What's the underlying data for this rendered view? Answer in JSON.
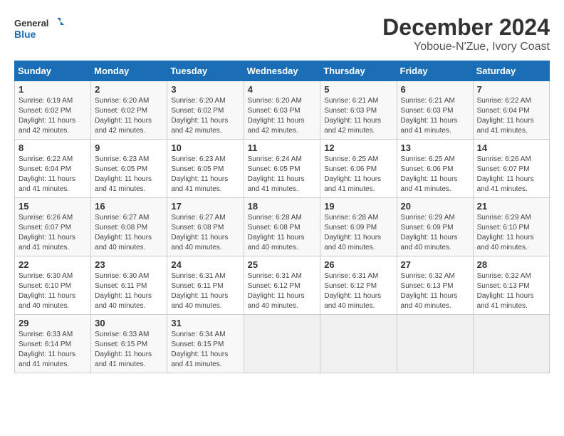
{
  "logo": {
    "text_general": "General",
    "text_blue": "Blue"
  },
  "title": "December 2024",
  "subtitle": "Yoboue-N'Zue, Ivory Coast",
  "days_of_week": [
    "Sunday",
    "Monday",
    "Tuesday",
    "Wednesday",
    "Thursday",
    "Friday",
    "Saturday"
  ],
  "weeks": [
    [
      {
        "day": "1",
        "sunrise": "6:19 AM",
        "sunset": "6:02 PM",
        "daylight": "11 hours and 42 minutes."
      },
      {
        "day": "2",
        "sunrise": "6:20 AM",
        "sunset": "6:02 PM",
        "daylight": "11 hours and 42 minutes."
      },
      {
        "day": "3",
        "sunrise": "6:20 AM",
        "sunset": "6:02 PM",
        "daylight": "11 hours and 42 minutes."
      },
      {
        "day": "4",
        "sunrise": "6:20 AM",
        "sunset": "6:03 PM",
        "daylight": "11 hours and 42 minutes."
      },
      {
        "day": "5",
        "sunrise": "6:21 AM",
        "sunset": "6:03 PM",
        "daylight": "11 hours and 42 minutes."
      },
      {
        "day": "6",
        "sunrise": "6:21 AM",
        "sunset": "6:03 PM",
        "daylight": "11 hours and 41 minutes."
      },
      {
        "day": "7",
        "sunrise": "6:22 AM",
        "sunset": "6:04 PM",
        "daylight": "11 hours and 41 minutes."
      }
    ],
    [
      {
        "day": "8",
        "sunrise": "6:22 AM",
        "sunset": "6:04 PM",
        "daylight": "11 hours and 41 minutes."
      },
      {
        "day": "9",
        "sunrise": "6:23 AM",
        "sunset": "6:05 PM",
        "daylight": "11 hours and 41 minutes."
      },
      {
        "day": "10",
        "sunrise": "6:23 AM",
        "sunset": "6:05 PM",
        "daylight": "11 hours and 41 minutes."
      },
      {
        "day": "11",
        "sunrise": "6:24 AM",
        "sunset": "6:05 PM",
        "daylight": "11 hours and 41 minutes."
      },
      {
        "day": "12",
        "sunrise": "6:25 AM",
        "sunset": "6:06 PM",
        "daylight": "11 hours and 41 minutes."
      },
      {
        "day": "13",
        "sunrise": "6:25 AM",
        "sunset": "6:06 PM",
        "daylight": "11 hours and 41 minutes."
      },
      {
        "day": "14",
        "sunrise": "6:26 AM",
        "sunset": "6:07 PM",
        "daylight": "11 hours and 41 minutes."
      }
    ],
    [
      {
        "day": "15",
        "sunrise": "6:26 AM",
        "sunset": "6:07 PM",
        "daylight": "11 hours and 41 minutes."
      },
      {
        "day": "16",
        "sunrise": "6:27 AM",
        "sunset": "6:08 PM",
        "daylight": "11 hours and 40 minutes."
      },
      {
        "day": "17",
        "sunrise": "6:27 AM",
        "sunset": "6:08 PM",
        "daylight": "11 hours and 40 minutes."
      },
      {
        "day": "18",
        "sunrise": "6:28 AM",
        "sunset": "6:08 PM",
        "daylight": "11 hours and 40 minutes."
      },
      {
        "day": "19",
        "sunrise": "6:28 AM",
        "sunset": "6:09 PM",
        "daylight": "11 hours and 40 minutes."
      },
      {
        "day": "20",
        "sunrise": "6:29 AM",
        "sunset": "6:09 PM",
        "daylight": "11 hours and 40 minutes."
      },
      {
        "day": "21",
        "sunrise": "6:29 AM",
        "sunset": "6:10 PM",
        "daylight": "11 hours and 40 minutes."
      }
    ],
    [
      {
        "day": "22",
        "sunrise": "6:30 AM",
        "sunset": "6:10 PM",
        "daylight": "11 hours and 40 minutes."
      },
      {
        "day": "23",
        "sunrise": "6:30 AM",
        "sunset": "6:11 PM",
        "daylight": "11 hours and 40 minutes."
      },
      {
        "day": "24",
        "sunrise": "6:31 AM",
        "sunset": "6:11 PM",
        "daylight": "11 hours and 40 minutes."
      },
      {
        "day": "25",
        "sunrise": "6:31 AM",
        "sunset": "6:12 PM",
        "daylight": "11 hours and 40 minutes."
      },
      {
        "day": "26",
        "sunrise": "6:31 AM",
        "sunset": "6:12 PM",
        "daylight": "11 hours and 40 minutes."
      },
      {
        "day": "27",
        "sunrise": "6:32 AM",
        "sunset": "6:13 PM",
        "daylight": "11 hours and 40 minutes."
      },
      {
        "day": "28",
        "sunrise": "6:32 AM",
        "sunset": "6:13 PM",
        "daylight": "11 hours and 41 minutes."
      }
    ],
    [
      {
        "day": "29",
        "sunrise": "6:33 AM",
        "sunset": "6:14 PM",
        "daylight": "11 hours and 41 minutes."
      },
      {
        "day": "30",
        "sunrise": "6:33 AM",
        "sunset": "6:15 PM",
        "daylight": "11 hours and 41 minutes."
      },
      {
        "day": "31",
        "sunrise": "6:34 AM",
        "sunset": "6:15 PM",
        "daylight": "11 hours and 41 minutes."
      },
      null,
      null,
      null,
      null
    ]
  ]
}
